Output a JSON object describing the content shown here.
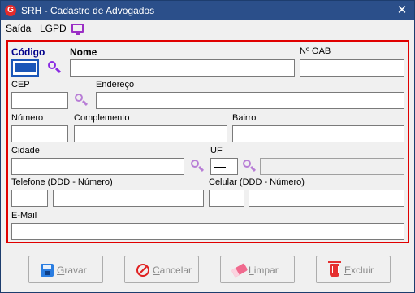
{
  "window": {
    "title": "SRH - Cadastro de Advogados",
    "app_icon_letter": "G",
    "close_glyph": "✕",
    "accent": "#2b4f8a",
    "highlight_border": "#e00000"
  },
  "menu": {
    "items": [
      "Saída",
      "LGPD"
    ],
    "lgpd_icon": "monitor-icon"
  },
  "form": {
    "codigo": {
      "label": "Código",
      "value": ""
    },
    "nome": {
      "label": "Nome",
      "value": ""
    },
    "oab": {
      "label": "Nº OAB",
      "value": ""
    },
    "cep": {
      "label": "CEP",
      "value": ""
    },
    "endereco": {
      "label": "Endereço",
      "value": ""
    },
    "numero": {
      "label": "Número",
      "value": ""
    },
    "complemento": {
      "label": "Complemento",
      "value": ""
    },
    "bairro": {
      "label": "Bairro",
      "value": ""
    },
    "cidade": {
      "label": "Cidade",
      "value": ""
    },
    "uf": {
      "label": "UF",
      "value": ""
    },
    "uf_desc": {
      "value": ""
    },
    "telefone": {
      "label": "Telefone (DDD - Número)",
      "ddd": "",
      "numero": ""
    },
    "celular": {
      "label": "Celular (DDD - Número)",
      "ddd": "",
      "numero": ""
    },
    "email": {
      "label": "E-Mail",
      "value": ""
    }
  },
  "buttons": {
    "gravar": {
      "label": "Gravar",
      "hotkey": "G",
      "rest": "ravar",
      "enabled": false
    },
    "cancelar": {
      "label": "Cancelar",
      "hotkey": "C",
      "rest": "ancelar",
      "enabled": false
    },
    "limpar": {
      "label": "Limpar",
      "hotkey": "L",
      "rest": "impar",
      "enabled": false
    },
    "excluir": {
      "label": "Excluir",
      "hotkey": "E",
      "rest": "xcluir",
      "enabled": false
    }
  }
}
